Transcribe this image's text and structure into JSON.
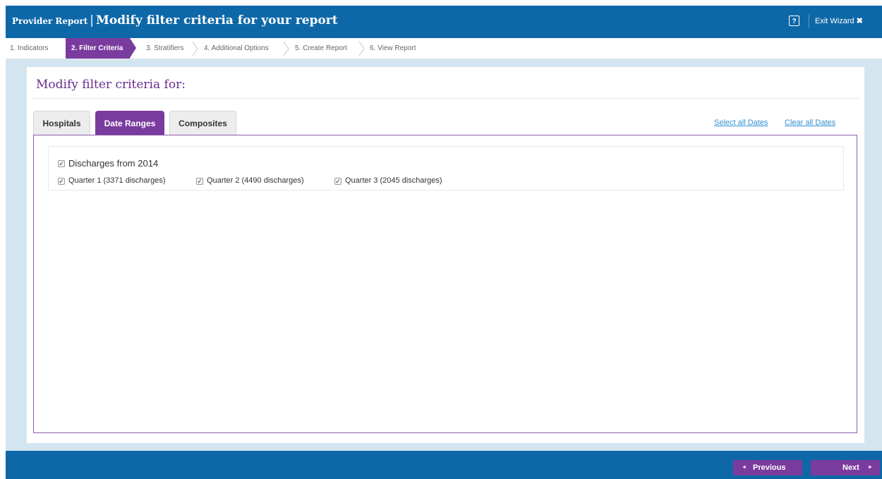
{
  "header": {
    "report_type": "Provider Report",
    "separator": "|",
    "title": "Modify filter criteria for your report",
    "help_label": "?",
    "exit_label": "Exit Wizard",
    "exit_icon": "✖"
  },
  "steps": [
    {
      "label": "1. Indicators"
    },
    {
      "label": "2. Filter Criteria",
      "active": true
    },
    {
      "label": "3. Stratifiers"
    },
    {
      "label": "4. Additional Options"
    },
    {
      "label": "5. Create Report"
    },
    {
      "label": "6. View Report"
    }
  ],
  "panel": {
    "title": "Modify filter criteria for:",
    "tabs": [
      {
        "label": "Hospitals"
      },
      {
        "label": "Date Ranges",
        "active": true
      },
      {
        "label": "Composites"
      }
    ],
    "select_all_label": "Select all Dates",
    "clear_all_label": "Clear all Dates"
  },
  "date_group": {
    "label": "Discharges from 2014",
    "checked": true,
    "quarters": [
      {
        "label": "Quarter 1 (3371 discharges)",
        "checked": true
      },
      {
        "label": "Quarter 2 (4490 discharges)",
        "checked": true
      },
      {
        "label": "Quarter 3 (2045 discharges)",
        "checked": true
      }
    ]
  },
  "footer": {
    "previous_label": "Previous",
    "next_label": "Next",
    "prev_icon": "◄",
    "next_icon": "►"
  },
  "colors": {
    "header_blue": "#0e68a8",
    "accent_purple": "#7a3b9e",
    "background": "#d3e6ef",
    "link_blue": "#2d8fd3"
  }
}
